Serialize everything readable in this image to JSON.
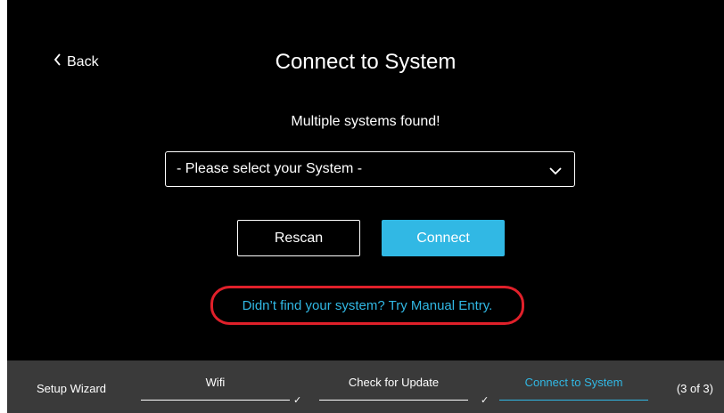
{
  "header": {
    "back_label": "Back",
    "title": "Connect to System"
  },
  "main": {
    "message": "Multiple systems found!",
    "system_select": {
      "selected": "- Please select your System -"
    },
    "rescan_label": "Rescan",
    "connect_label": "Connect",
    "manual_entry_link": "Didn’t find your system? Try Manual Entry."
  },
  "footer": {
    "wizard_label": "Setup Wizard",
    "steps": [
      {
        "label": "Wifi",
        "completed": true,
        "active": false
      },
      {
        "label": "Check for Update",
        "completed": true,
        "active": false
      },
      {
        "label": "Connect to System",
        "completed": false,
        "active": true
      }
    ],
    "progress": "(3 of 3)"
  },
  "colors": {
    "accent": "#31b8e4",
    "highlight_ring": "#e0202a",
    "background": "#000000",
    "footer_background": "#3a3a3a"
  }
}
